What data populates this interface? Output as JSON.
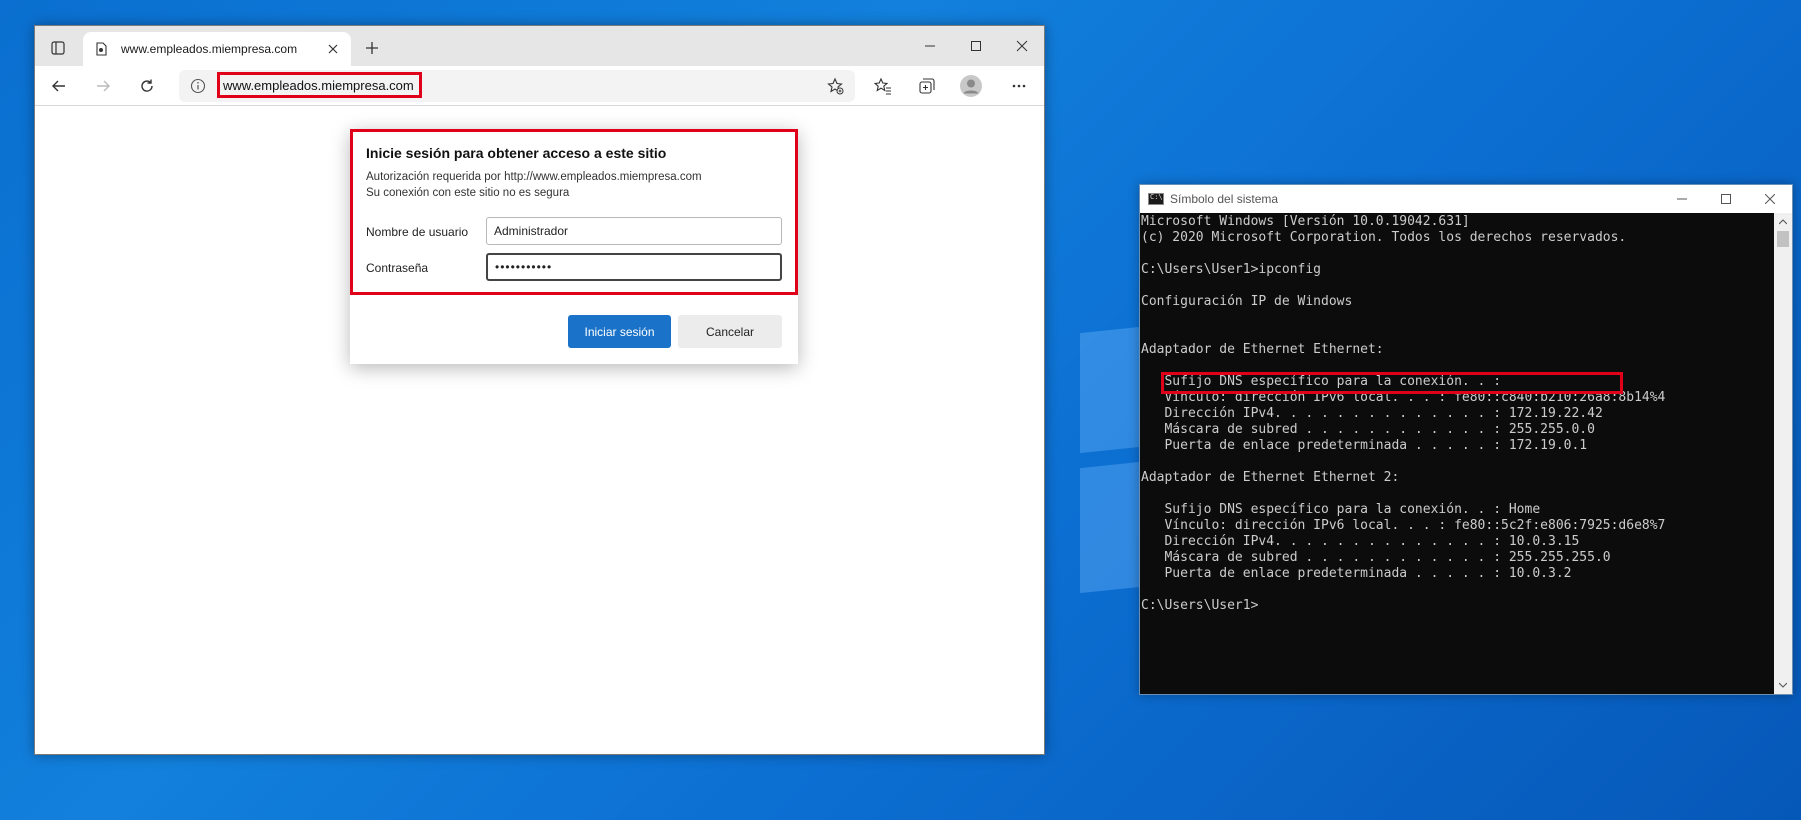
{
  "browser": {
    "tab_title": "www.empleados.miempresa.com",
    "url": "www.empleados.miempresa.com"
  },
  "dialog": {
    "title": "Inicie sesión para obtener acceso a este sitio",
    "auth_required": "Autorización requerida por http://www.empleados.miempresa.com",
    "insecure_notice": "Su conexión con este sitio no es segura",
    "username_label": "Nombre de usuario",
    "username_value": "Administrador",
    "password_label": "Contraseña",
    "password_value": "•••••••••••",
    "signin_label": "Iniciar sesión",
    "cancel_label": "Cancelar"
  },
  "cmd": {
    "title": "Símbolo del sistema",
    "lines": [
      "Microsoft Windows [Versión 10.0.19042.631]",
      "(c) 2020 Microsoft Corporation. Todos los derechos reservados.",
      "",
      "C:\\Users\\User1>ipconfig",
      "",
      "Configuración IP de Windows",
      "",
      "",
      "Adaptador de Ethernet Ethernet:",
      "",
      "   Sufijo DNS específico para la conexión. . :",
      "   Vínculo: dirección IPv6 local. . . : fe80::c840:b210:26a8:8b14%4",
      "   Dirección IPv4. . . . . . . . . . . . . . : 172.19.22.42",
      "   Máscara de subred . . . . . . . . . . . . : 255.255.0.0",
      "   Puerta de enlace predeterminada . . . . . : 172.19.0.1",
      "",
      "Adaptador de Ethernet Ethernet 2:",
      "",
      "   Sufijo DNS específico para la conexión. . : Home",
      "   Vínculo: dirección IPv6 local. . . : fe80::5c2f:e806:7925:d6e8%7",
      "   Dirección IPv4. . . . . . . . . . . . . . : 10.0.3.15",
      "   Máscara de subred . . . . . . . . . . . . : 255.255.255.0",
      "   Puerta de enlace predeterminada . . . . . : 10.0.3.2",
      "",
      "C:\\Users\\User1>"
    ]
  },
  "colors": {
    "highlight": "#e0001a",
    "primary_button": "#1a73c8",
    "desktop": "#0a6fd0"
  }
}
